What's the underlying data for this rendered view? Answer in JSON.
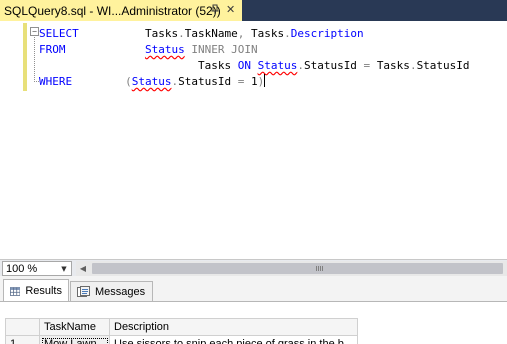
{
  "document_tab": {
    "title": "SQLQuery8.sql - WI...Administrator (52))",
    "close_glyph": "✕",
    "pin_icon": "pin-icon",
    "active_color": "#fff29d",
    "bar_color": "#293955"
  },
  "editor": {
    "outline_glyph": "−",
    "lines": {
      "l1": {
        "kw": "SELECT",
        "pad": "          ",
        "t1": "Tasks",
        "d1": ".",
        "t2": "TaskName",
        "c": ", ",
        "t3": "Tasks",
        "d2": ".",
        "t4": "Description"
      },
      "l2": {
        "kw": "FROM",
        "pad": "            ",
        "t1": "Status",
        "op": " INNER JOIN"
      },
      "l3": {
        "pad": "                        ",
        "t1": "Tasks ",
        "kw": "ON",
        "sp": " ",
        "t2": "Status",
        "d1": ".",
        "t3": "StatusId",
        "eq": " = ",
        "t4": "Tasks",
        "d2": ".",
        "t5": "StatusId"
      },
      "l4": {
        "kw": "WHERE",
        "pad": "        ",
        "p1": "(",
        "t1": "Status",
        "d1": ".",
        "t2": "StatusId",
        "eq": " = ",
        "num": "1",
        "p2": ")"
      }
    },
    "colors": {
      "keyword": "#0000ff",
      "operator": "#808080",
      "squiggle": "#ff0000"
    }
  },
  "zoom": {
    "value": "100 %",
    "arrow_glyph": "▼"
  },
  "scrollbar": {
    "left_glyph": "◀"
  },
  "results": {
    "tabs": [
      {
        "label": "Results",
        "icon": "grid-icon"
      },
      {
        "label": "Messages",
        "icon": "messages-icon"
      }
    ],
    "columns": [
      "TaskName",
      "Description"
    ],
    "rows": [
      {
        "row_number": "1",
        "TaskName": "Mow Lawn",
        "Description": "Use sissors to snip each piece of grass in the b..."
      }
    ]
  }
}
